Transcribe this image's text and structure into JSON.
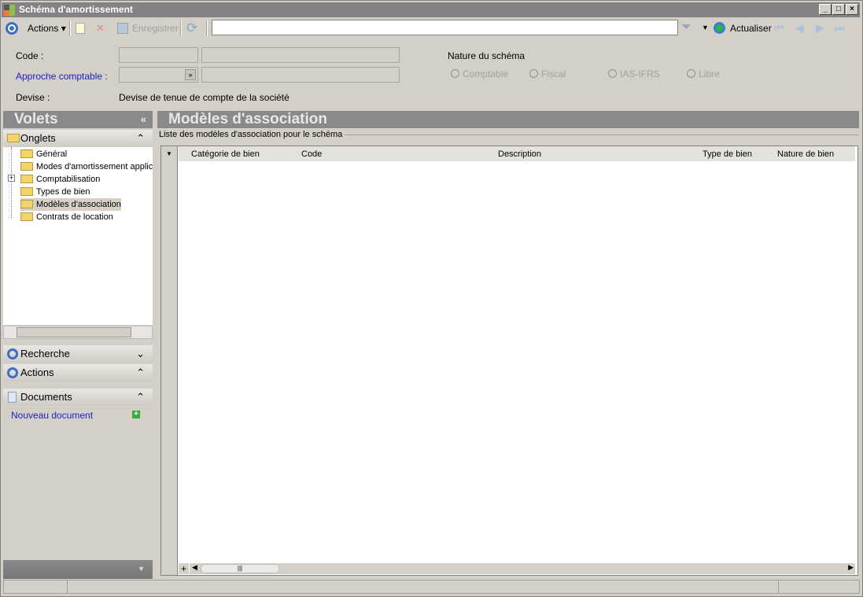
{
  "window": {
    "title": "Schéma d'amortissement",
    "minimize": "_",
    "maximize": "□",
    "close": "×"
  },
  "toolbar": {
    "actions": "Actions",
    "save": "Enregistrer",
    "search_value": "",
    "refresh": "Actualiser"
  },
  "form": {
    "code_label": "Code :",
    "approche_label": "Approche comptable :",
    "devise_label": "Devise :",
    "devise_value": "Devise de tenue de compte de la société",
    "nature_label": "Nature du schéma",
    "nature_options": [
      "Comptable",
      "Fiscal",
      "IAS-IFRS",
      "Libre"
    ]
  },
  "sidebar": {
    "title": "Volets",
    "onglets": "Onglets",
    "tree": [
      "Général",
      "Modes d'amortissement applica",
      "Comptabilisation",
      "Types de bien",
      "Modèles d'association",
      "Contrats de location"
    ],
    "recherche": "Recherche",
    "actions": "Actions",
    "documents": "Documents",
    "new_document": "Nouveau document"
  },
  "main": {
    "title": "Modèles d'association",
    "group_label": "Liste des modèles d'association pour le schéma",
    "columns": [
      "Catégorie de bien",
      "Code",
      "Description",
      "Type de bien",
      "Nature de bien"
    ],
    "rows": []
  }
}
